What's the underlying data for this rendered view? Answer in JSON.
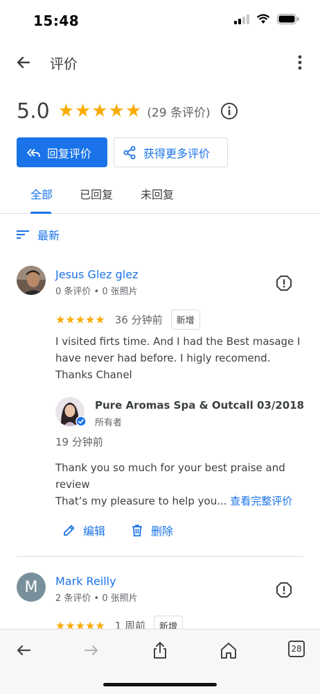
{
  "status_bar": {
    "time": "15:48"
  },
  "app_bar": {
    "title": "评价"
  },
  "summary": {
    "rating": "5.0",
    "count_text": "(29 条评价)"
  },
  "buttons": {
    "reply": "回复评价",
    "get_more": "获得更多评价"
  },
  "tabs": [
    {
      "label": "全部",
      "active": true
    },
    {
      "label": "已回复",
      "active": false
    },
    {
      "label": "未回复",
      "active": false
    }
  ],
  "sort": {
    "label": "最新"
  },
  "reviews": [
    {
      "name": "Jesus Glez glez",
      "meta": "0 条评价 • 0 张照片",
      "stars": "★★★★★",
      "time": "36 分钟前",
      "badge": "新增",
      "text": "I visited firts time. And I had the Best masage I have never had before. I higly recomend. Thanks Chanel",
      "reply": {
        "owner_name": "Pure Aromas Spa & Outcall 03/2018",
        "owner_role": "所有者",
        "time": "19 分钟前",
        "text_line1": "Thank you so much for your best praise and review",
        "text_line2": "That’s my pleasure to help you...",
        "see_full": "查看完整评价"
      },
      "actions": {
        "edit": "编辑",
        "delete": "删除"
      }
    },
    {
      "initial": "M",
      "name": "Mark Reilly",
      "meta": "2 条评价 • 0 张照片",
      "stars": "★★★★★",
      "time": "1 周前",
      "badge": "新增"
    }
  ],
  "browser": {
    "tab_count": "28"
  },
  "colors": {
    "accent": "#1a73e8",
    "star": "#f9ab00",
    "text": "#3c4043",
    "muted": "#5f6368"
  }
}
